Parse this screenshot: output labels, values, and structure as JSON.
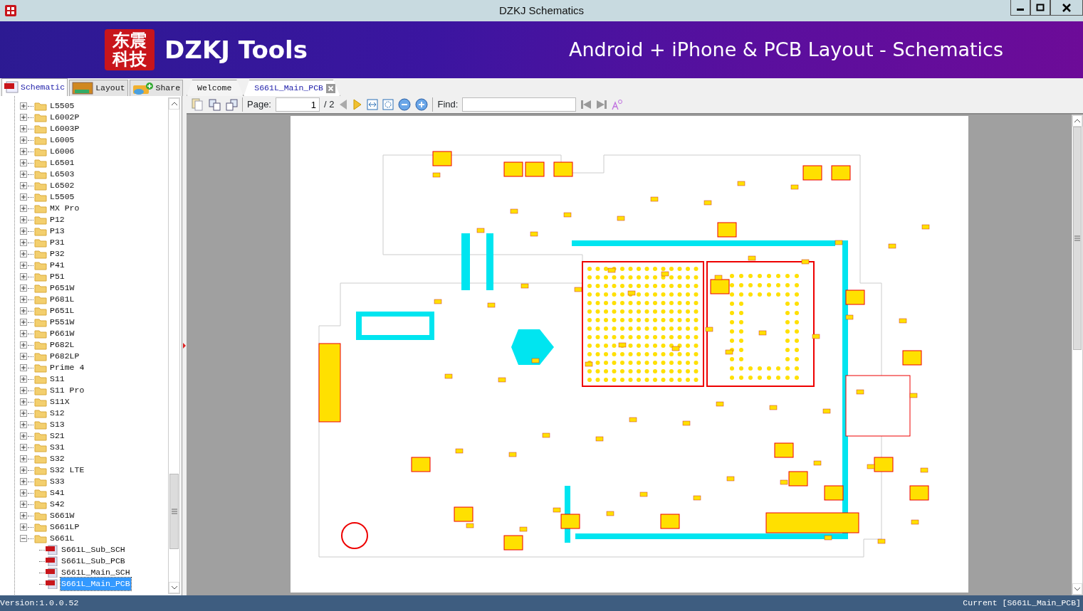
{
  "window": {
    "title": "DZKJ Schematics"
  },
  "banner": {
    "logo_lines": [
      "东震",
      "科技"
    ],
    "brand": "DZKJ Tools",
    "tagline": "Android + iPhone & PCB Layout - Schematics"
  },
  "side_tabs": [
    {
      "label": "Schematic",
      "kind": "pdf",
      "selected": true
    },
    {
      "label": "Layout",
      "kind": "pads",
      "selected": false
    },
    {
      "label": "Share",
      "kind": "share",
      "selected": false
    }
  ],
  "doc_tabs": [
    {
      "label": "Welcome",
      "selected": false,
      "closable": false
    },
    {
      "label": "S661L_Main_PCB",
      "selected": true,
      "closable": true
    }
  ],
  "toolbar": {
    "page_label": "Page:",
    "page_value": "1",
    "page_total": "/ 2",
    "find_label": "Find:"
  },
  "tree": [
    {
      "label": "L5505",
      "expanded": false,
      "selected": false
    },
    {
      "label": "L6002P",
      "expanded": false,
      "selected": false
    },
    {
      "label": "L6003P",
      "expanded": false,
      "selected": false
    },
    {
      "label": "L6005",
      "expanded": false,
      "selected": false
    },
    {
      "label": "L6006",
      "expanded": false,
      "selected": false
    },
    {
      "label": "L6501",
      "expanded": false,
      "selected": false
    },
    {
      "label": "L6503",
      "expanded": false,
      "selected": false
    },
    {
      "label": "L6502",
      "expanded": false,
      "selected": false
    },
    {
      "label": "L5505",
      "expanded": false,
      "selected": false
    },
    {
      "label": "MX Pro",
      "expanded": false,
      "selected": false
    },
    {
      "label": "P12",
      "expanded": false,
      "selected": false
    },
    {
      "label": "P13",
      "expanded": false,
      "selected": false
    },
    {
      "label": "P31",
      "expanded": false,
      "selected": false
    },
    {
      "label": "P32",
      "expanded": false,
      "selected": false
    },
    {
      "label": "P41",
      "expanded": false,
      "selected": false
    },
    {
      "label": "P51",
      "expanded": false,
      "selected": false
    },
    {
      "label": "P651W",
      "expanded": false,
      "selected": false
    },
    {
      "label": "P681L",
      "expanded": false,
      "selected": false
    },
    {
      "label": "P651L",
      "expanded": false,
      "selected": false
    },
    {
      "label": "P551W",
      "expanded": false,
      "selected": false
    },
    {
      "label": "P661W",
      "expanded": false,
      "selected": false
    },
    {
      "label": "P682L",
      "expanded": false,
      "selected": false
    },
    {
      "label": "P682LP",
      "expanded": false,
      "selected": false
    },
    {
      "label": "Prime 4",
      "expanded": false,
      "selected": false
    },
    {
      "label": "S11",
      "expanded": false,
      "selected": false
    },
    {
      "label": "S11 Pro",
      "expanded": false,
      "selected": false
    },
    {
      "label": "S11X",
      "expanded": false,
      "selected": false
    },
    {
      "label": "S12",
      "expanded": false,
      "selected": false
    },
    {
      "label": "S13",
      "expanded": false,
      "selected": false
    },
    {
      "label": "S21",
      "expanded": false,
      "selected": false
    },
    {
      "label": "S31",
      "expanded": false,
      "selected": false
    },
    {
      "label": "S32",
      "expanded": false,
      "selected": false
    },
    {
      "label": "S32 LTE",
      "expanded": false,
      "selected": false
    },
    {
      "label": "S33",
      "expanded": false,
      "selected": false
    },
    {
      "label": "S41",
      "expanded": false,
      "selected": false
    },
    {
      "label": "S42",
      "expanded": false,
      "selected": false
    },
    {
      "label": "S661W",
      "expanded": false,
      "selected": false
    },
    {
      "label": "S661LP",
      "expanded": false,
      "selected": false
    },
    {
      "label": "S661L",
      "expanded": true,
      "selected": false,
      "children": [
        {
          "label": "S661L_Sub_SCH",
          "selected": false
        },
        {
          "label": "S661L_Sub_PCB",
          "selected": false
        },
        {
          "label": "S661L_Main_SCH",
          "selected": false
        },
        {
          "label": "S661L_Main_PCB",
          "selected": true
        }
      ]
    }
  ],
  "status_bar": {
    "version": "Version:1.0.0.52",
    "current": "Current [S661L_Main_PCB]"
  }
}
